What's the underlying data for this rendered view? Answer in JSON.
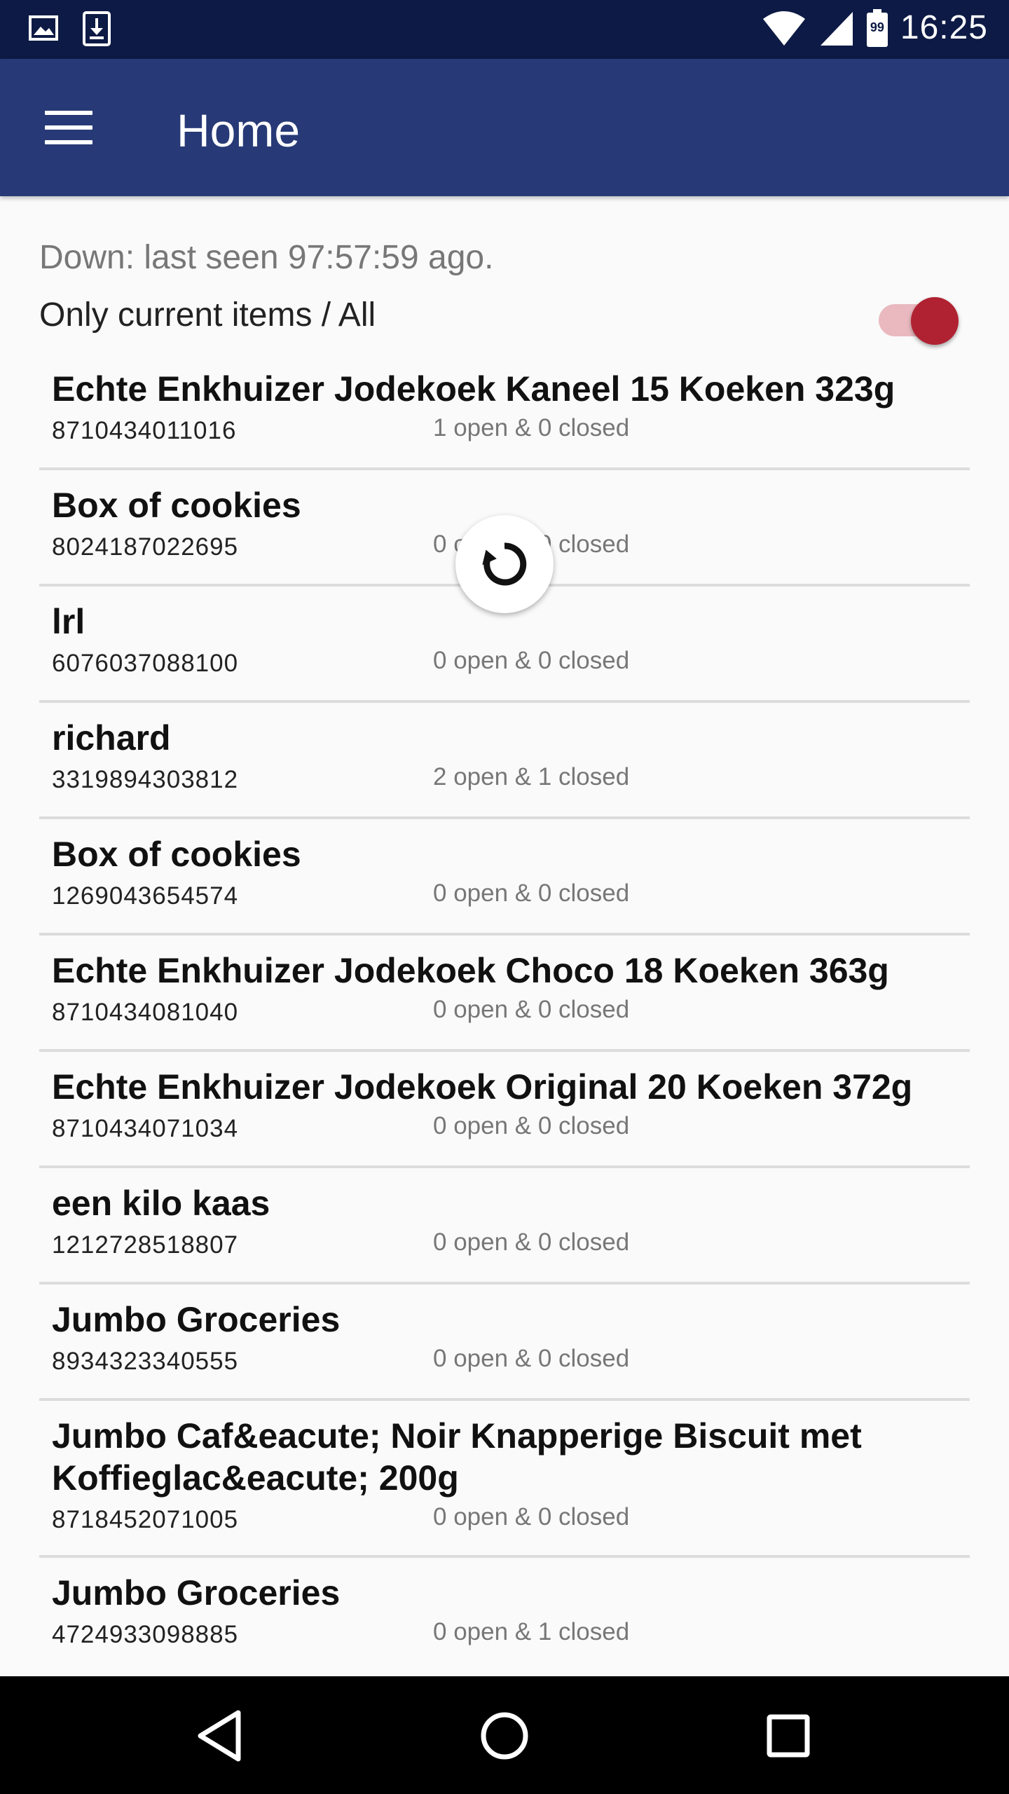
{
  "status_bar": {
    "time": "16:25",
    "battery_level": "99",
    "icons": [
      "image-icon",
      "download-icon",
      "wifi-icon",
      "signal-icon",
      "battery-icon"
    ]
  },
  "toolbar": {
    "title": "Home",
    "menu_icon": "hamburger-menu-icon",
    "color": "#273a77"
  },
  "status_line": "Down: last seen 97:57:59 ago.",
  "filter": {
    "label": "Only current items / All",
    "toggle_on": true,
    "accent": "#b02232"
  },
  "items": [
    {
      "name": "Echte Enkhuizer Jodekoek Kaneel 15 Koeken 323g",
      "code": "8710434011016",
      "count": "1 open & 0 closed"
    },
    {
      "name": "Box of cookies",
      "code": "8024187022695",
      "count": "0 open & 0 closed"
    },
    {
      "name": "lrl",
      "code": "6076037088100",
      "count": "0 open & 0 closed"
    },
    {
      "name": "richard",
      "code": "3319894303812",
      "count": "2 open & 1 closed"
    },
    {
      "name": "Box of cookies",
      "code": "1269043654574",
      "count": "0 open & 0 closed"
    },
    {
      "name": "Echte Enkhuizer Jodekoek Choco 18 Koeken 363g",
      "code": "8710434081040",
      "count": "0 open & 0 closed"
    },
    {
      "name": "Echte Enkhuizer Jodekoek Original 20 Koeken 372g",
      "code": "8710434071034",
      "count": "0 open & 0 closed"
    },
    {
      "name": "een kilo kaas",
      "code": "1212728518807",
      "count": "0 open & 0 closed"
    },
    {
      "name": "Jumbo Groceries",
      "code": "8934323340555",
      "count": "0 open & 0 closed"
    },
    {
      "name": "Jumbo Caf&eacute; Noir Knapperige Biscuit met Koffieglac&eacute; 200g",
      "code": "8718452071005",
      "count": "0 open & 0 closed"
    },
    {
      "name": "Jumbo Groceries",
      "code": "4724933098885",
      "count": "0 open & 1 closed"
    }
  ],
  "refresh_icon": "refresh-icon",
  "nav": [
    "back-icon",
    "home-icon",
    "recents-icon"
  ]
}
